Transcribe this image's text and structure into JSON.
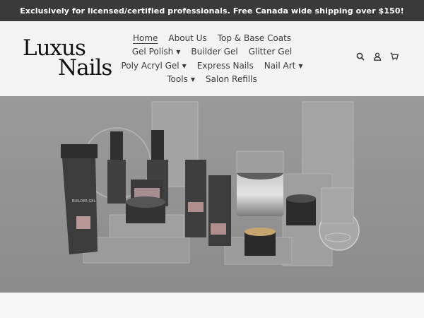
{
  "announcement": {
    "text": "Exclusively for licensed/certified professionals. Free Canada wide shipping over $150!"
  },
  "logo": {
    "line1": "Luxus",
    "line2": "Nails"
  },
  "nav": {
    "rows": [
      [
        {
          "label": "Home",
          "active": true
        },
        {
          "label": "About Us"
        },
        {
          "label": "Top & Base Coats"
        }
      ],
      [
        {
          "label": "Gel Polish",
          "dropdown": true
        },
        {
          "label": "Builder Gel"
        },
        {
          "label": "Glitter Gel"
        }
      ],
      [
        {
          "label": "Poly Acryl Gel",
          "dropdown": true
        },
        {
          "label": "Express Nails"
        },
        {
          "label": "Nail Art",
          "dropdown": true
        }
      ],
      [
        {
          "label": "Tools",
          "dropdown": true
        },
        {
          "label": "Salon Refills"
        }
      ]
    ]
  },
  "header_icons": [
    "search-icon",
    "account-icon",
    "cart-icon"
  ],
  "hero": {
    "image_subject": "nail gel product collection display",
    "tube_labels": [
      "BUILDER GEL"
    ]
  },
  "colors": {
    "announcement_bg": "#3a3a3a",
    "header_bg": "#f3f3f3",
    "hero_bg": "#969696"
  }
}
